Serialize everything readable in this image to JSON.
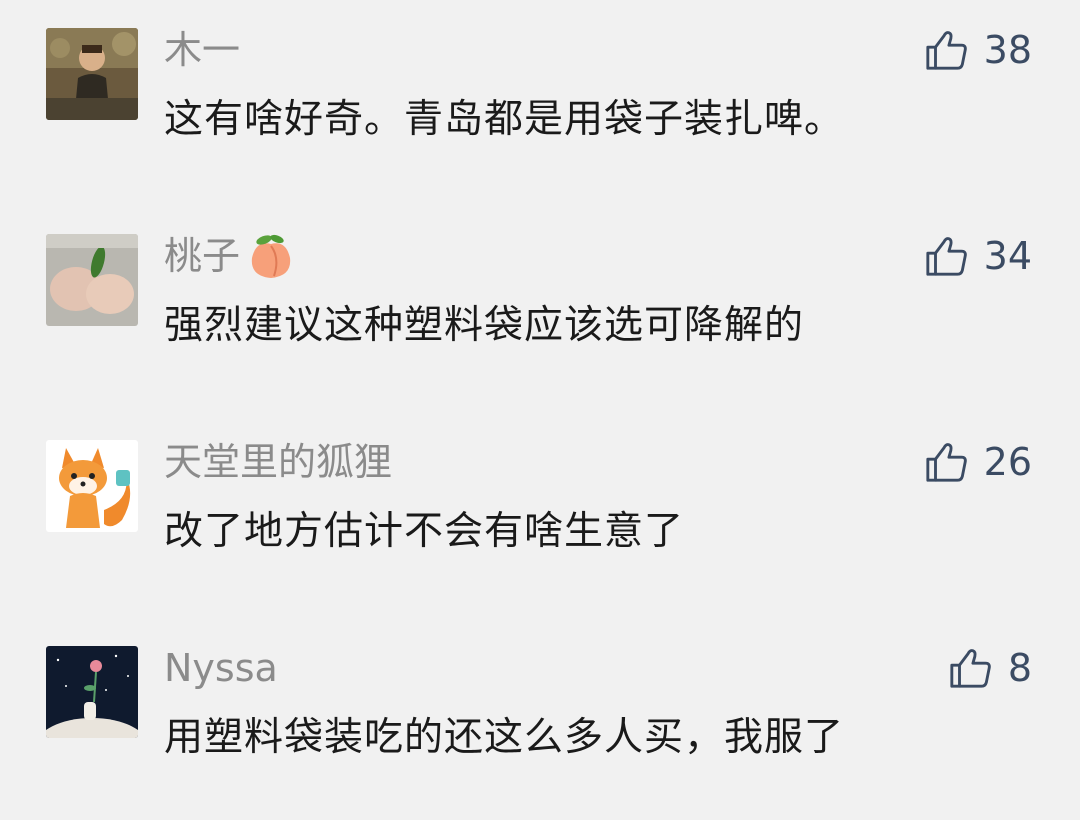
{
  "comments": [
    {
      "avatar_icon": "child-photo-avatar",
      "nickname": "木一",
      "nickname_emoji": "",
      "text": "这有啥好奇。青岛都是用袋子装扎啤。",
      "likes": "38",
      "like_icon": "thumbs-up-icon"
    },
    {
      "avatar_icon": "hands-photo-avatar",
      "nickname": "桃子",
      "nickname_emoji": "peach-emoji",
      "text": "强烈建议这种塑料袋应该选可降解的",
      "likes": "34",
      "like_icon": "thumbs-up-icon"
    },
    {
      "avatar_icon": "cartoon-fox-avatar",
      "nickname": "天堂里的狐狸",
      "nickname_emoji": "",
      "text": "改了地方估计不会有啥生意了",
      "likes": "26",
      "like_icon": "thumbs-up-icon"
    },
    {
      "avatar_icon": "night-sky-avatar",
      "nickname": "Nyssa",
      "nickname_emoji": "",
      "text": "用塑料袋装吃的还这么多人买，我服了",
      "likes": "8",
      "like_icon": "thumbs-up-icon"
    }
  ],
  "colors": {
    "background": "#f1f1f1",
    "nickname": "#8b8b8b",
    "text": "#1a1a1a",
    "like": "#3b4b63"
  }
}
